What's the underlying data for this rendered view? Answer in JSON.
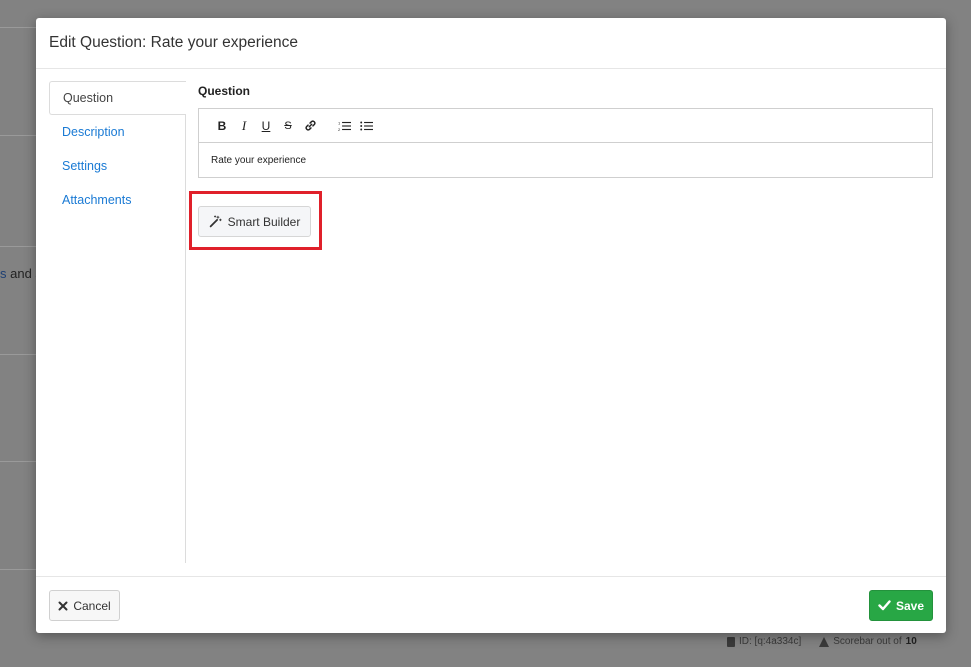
{
  "background": {
    "partial_text_link": "s",
    "partial_text": " and s",
    "footer_id": "ID: [q:4a334c]",
    "footer_scorebar": "Scorebar out of ",
    "footer_scorebar_value": "10"
  },
  "modal": {
    "title": "Edit Question: Rate your experience",
    "nav": [
      {
        "label": "Question",
        "active": true
      },
      {
        "label": "Description",
        "active": false
      },
      {
        "label": "Settings",
        "active": false
      },
      {
        "label": "Attachments",
        "active": false
      }
    ],
    "question_label": "Question",
    "editor": {
      "toolbar": {
        "bold": "B",
        "italic": "I",
        "underline": "U",
        "strike": "S"
      },
      "content": "Rate your experience"
    },
    "smart_builder_label": "Smart Builder",
    "cancel_label": "Cancel",
    "save_label": "Save",
    "colors": {
      "link": "#1a7ad4",
      "save": "#28a745",
      "highlight": "#e0202a"
    },
    "icons": [
      "bold-icon",
      "italic-icon",
      "underline-icon",
      "strikethrough-icon",
      "link-icon",
      "ordered-list-icon",
      "unordered-list-icon",
      "magic-wand-icon",
      "close-icon",
      "check-icon"
    ]
  }
}
